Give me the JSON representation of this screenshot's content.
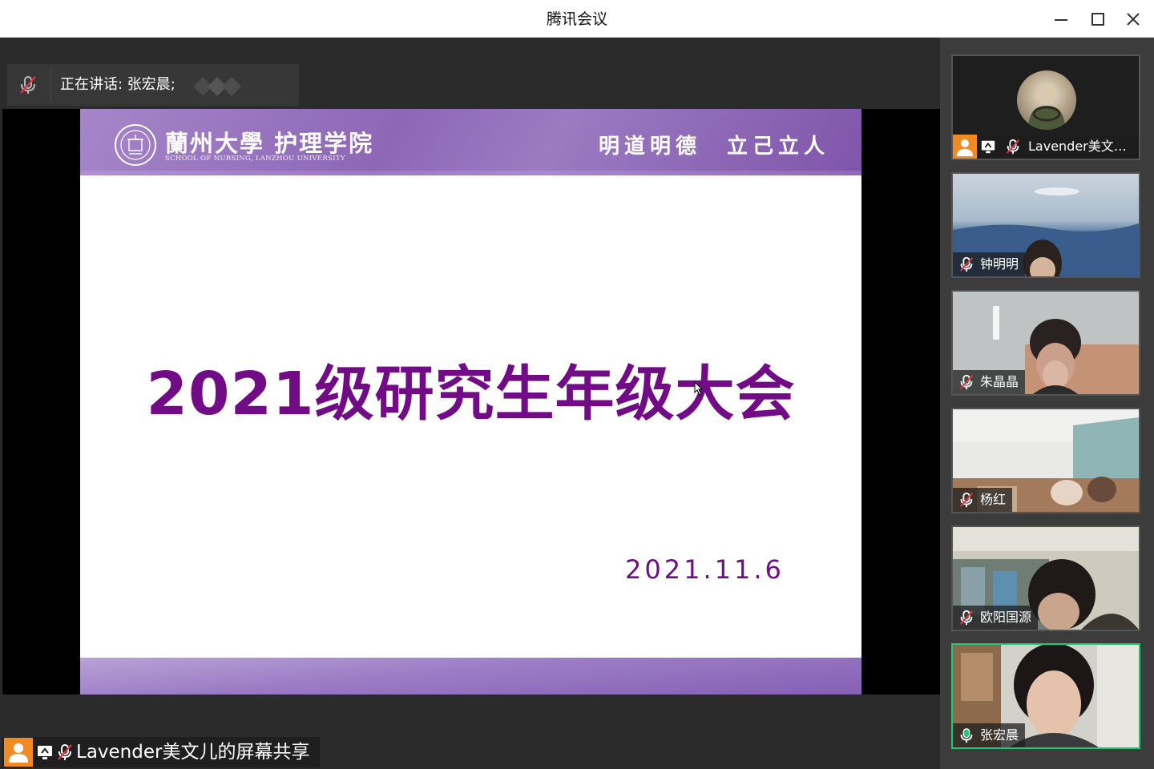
{
  "window": {
    "title": "腾讯会议"
  },
  "speaking": {
    "text": "正在讲话: 张宏晨;"
  },
  "slide": {
    "school_cn": "蘭州大學 护理学院",
    "school_en": "SCHOOL OF NURSING, LANZHOU UNIVERSITY",
    "motto": "明道明德　立己立人",
    "title": "2021级研究生年级大会",
    "date": "2021.11.6"
  },
  "share": {
    "label": "Lavender美文儿的屏幕共享"
  },
  "participants": [
    {
      "name": "Lavender美文儿的屏幕共享",
      "muted": true,
      "sharing": true,
      "type": "avatar"
    },
    {
      "name": "钟明明",
      "muted": true
    },
    {
      "name": "朱晶晶",
      "muted": true
    },
    {
      "name": "杨红",
      "muted": true
    },
    {
      "name": "欧阳国源",
      "muted": true
    },
    {
      "name": "张宏晨",
      "muted": false,
      "speaking": true
    }
  ],
  "colors": {
    "slide_title": "#720c86",
    "slide_header": "#8e67b7",
    "active_border": "#21c873",
    "avatar_orange": "#f08a24",
    "mic_muted_red": "#e0383e"
  }
}
